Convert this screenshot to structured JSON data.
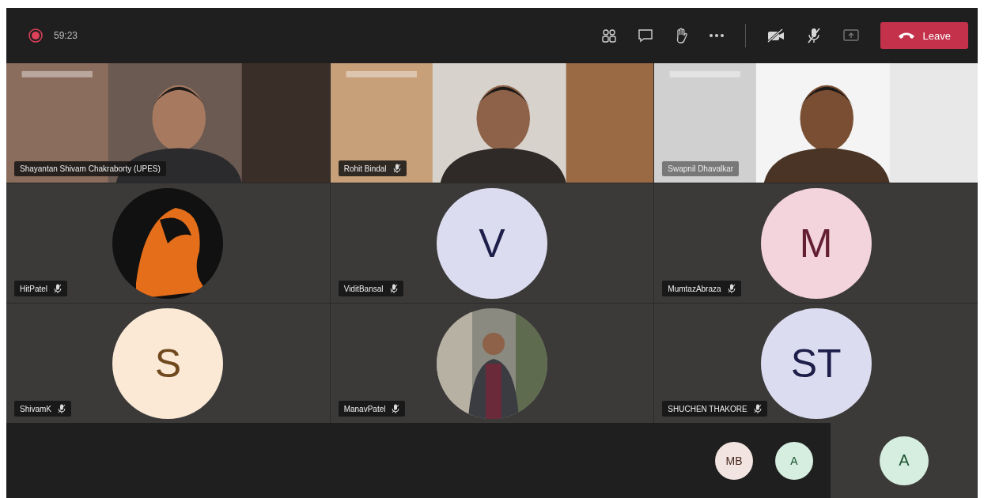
{
  "toolbar": {
    "recording": true,
    "timer": "59:23",
    "camera_off": true,
    "mic_off": true,
    "leave_label": "Leave"
  },
  "tiles": [
    {
      "kind": "video",
      "name": "Shayantan Shivam Chakraborty (UPES)",
      "muted": false
    },
    {
      "kind": "video",
      "name": "Rohit Bindal",
      "muted": true
    },
    {
      "kind": "video",
      "name": "Swapnil Dhavalkar",
      "muted": false
    },
    {
      "name": "HitPatel",
      "muted": true
    },
    {
      "kind": "initials",
      "name": "ViditBansal",
      "muted": true,
      "initials": "V",
      "color": "#dcdcf0"
    },
    {
      "kind": "initials",
      "name": "MumtazAbraza",
      "muted": true,
      "initials": "M",
      "color": "#f3d3dc"
    },
    {
      "kind": "initials",
      "name": "ShivamK",
      "muted": true,
      "initials": "S",
      "color": "#fbe9d6"
    },
    {
      "name": "ManavPatel",
      "muted": true
    },
    {
      "kind": "initials",
      "name": "SHUCHEN THAKORE",
      "muted": true,
      "initials": "ST",
      "color": "#dcdcf0"
    }
  ],
  "overflow": [
    {
      "initials": "MB",
      "color": "#f2e4e0"
    },
    {
      "initials": "A",
      "color": "#d5eedf"
    }
  ],
  "self_view": {
    "initials": "A",
    "color": "#d5eedf"
  }
}
